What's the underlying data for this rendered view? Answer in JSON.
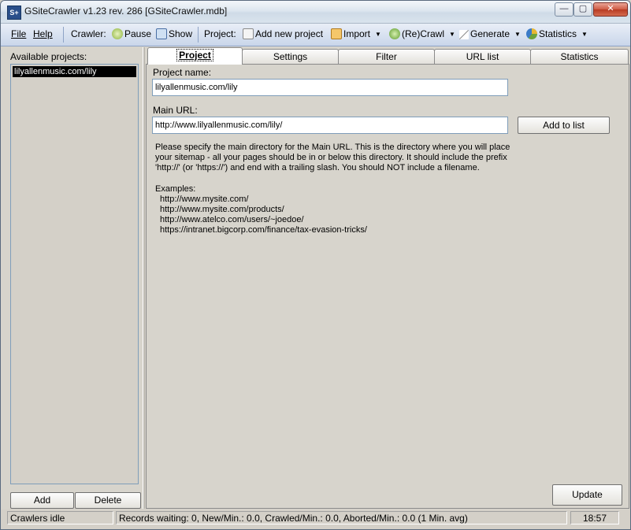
{
  "window": {
    "title": "GSiteCrawler v1.23 rev. 286 [GSiteCrawler.mdb]",
    "icon_text": "S+",
    "controls": {
      "minimize": "—",
      "maximize": "▢",
      "close": "✕"
    }
  },
  "toolbar": {
    "file": "File",
    "help": "Help",
    "crawler_label": "Crawler:",
    "pause": "Pause",
    "show": "Show",
    "project_label": "Project:",
    "add_new_project": "Add new project",
    "import": "Import",
    "recrawl": "(Re)Crawl",
    "generate": "Generate",
    "statistics": "Statistics",
    "dropdown_glyph": "▼"
  },
  "sidebar": {
    "label": "Available projects:",
    "projects": [
      "lilyallenmusic.com/lily"
    ],
    "add_button": "Add",
    "delete_button": "Delete"
  },
  "tabs": [
    "Project",
    "Settings",
    "Filter",
    "URL list",
    "Statistics"
  ],
  "project_tab": {
    "name_label": "Project name:",
    "name_value": "lilyallenmusic.com/lily",
    "url_label": "Main URL:",
    "url_value": "http://www.lilyallenmusic.com/lily/",
    "add_to_list": "Add to list",
    "help_text": "Please specify the main directory for the Main URL. This is the directory where you will place your sitemap - all your pages should be in or below this directory. It should include the prefix 'http://' (or 'https://') and end with a trailing slash.  You should NOT include a filename.",
    "examples_label": "Examples:",
    "examples": [
      "http://www.mysite.com/",
      "http://www.mysite.com/products/",
      "http://www.atelco.com/users/~joedoe/",
      "https://intranet.bigcorp.com/finance/tax-evasion-tricks/"
    ],
    "update_button": "Update"
  },
  "statusbar": {
    "state": "Crawlers idle",
    "records": "Records waiting: 0, New/Min.: 0.0, Crawled/Min.: 0.0, Aborted/Min.: 0.0 (1 Min. avg)",
    "time": "18:57"
  },
  "colors": {
    "selection": "#000000",
    "toolbar_gradient_top": "#e9eef7",
    "toolbar_gradient_bottom": "#c9d6ea",
    "close_button": "#c94a32"
  },
  "icons": {
    "pause": "pause-icon",
    "show": "magnifier-icon",
    "add_new_project": "add-project-icon",
    "import": "import-icon",
    "recrawl": "crawl-icon",
    "generate": "generate-icon",
    "statistics": "pie-chart-icon"
  }
}
